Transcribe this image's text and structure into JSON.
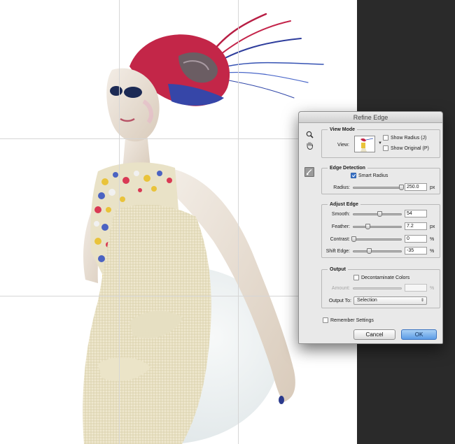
{
  "dialog": {
    "title": "Refine Edge",
    "view_mode": {
      "title": "View Mode",
      "view_label": "View:",
      "show_radius_label": "Show Radius (J)",
      "show_radius_checked": false,
      "show_original_label": "Show Original (P)",
      "show_original_checked": false
    },
    "edge_detection": {
      "title": "Edge Detection",
      "smart_radius_label": "Smart Radius",
      "smart_radius_checked": true,
      "radius_label": "Radius:",
      "radius_value": "250.0",
      "radius_unit": "px",
      "radius_fraction": 1.0
    },
    "adjust_edge": {
      "title": "Adjust Edge",
      "smooth_label": "Smooth:",
      "smooth_value": "54",
      "smooth_fraction": 0.54,
      "feather_label": "Feather:",
      "feather_value": "7.2",
      "feather_unit": "px",
      "feather_fraction": 0.3,
      "contrast_label": "Contrast:",
      "contrast_value": "0",
      "contrast_unit": "%",
      "contrast_fraction": 0.0,
      "shift_edge_label": "Shift Edge:",
      "shift_edge_value": "-35",
      "shift_edge_unit": "%",
      "shift_edge_fraction": 0.32
    },
    "output": {
      "title": "Output",
      "decontaminate_label": "Decontaminate Colors",
      "decontaminate_checked": false,
      "amount_label": "Amount:",
      "amount_value": "",
      "amount_unit": "%",
      "output_to_label": "Output To:",
      "output_to_value": "Selection"
    },
    "remember_settings_label": "Remember Settings",
    "remember_settings_checked": false,
    "cancel_label": "Cancel",
    "ok_label": "OK"
  },
  "colors": {
    "canvas_dark": "#2a2a2a",
    "ok_button": "#5c9ce6",
    "checkbox_on": "#3f76c9"
  },
  "icons": [
    "zoom-icon",
    "hand-icon",
    "refine-radius-brush-icon",
    "chevron-down-icon",
    "select-arrows-icon"
  ]
}
